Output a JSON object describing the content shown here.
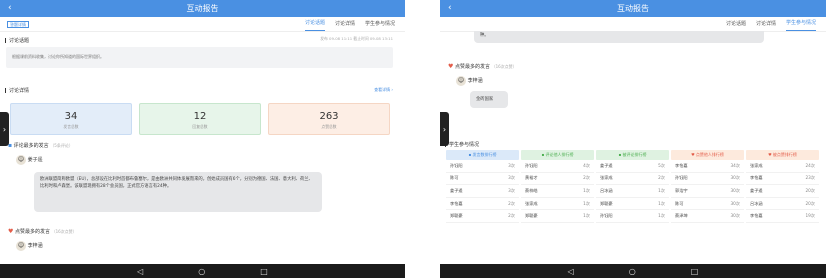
{
  "header": {
    "title": "互动报告",
    "back": "‹"
  },
  "tabs": [
    "讨论话题",
    "讨论详情",
    "学生参与情况"
  ],
  "tag": "答题详情",
  "left": {
    "topic_section": "讨论话题",
    "meta": "发布 09-08 11:11   截止时间 09-08 13:11",
    "topic_text": "根据课前资料收集，讨论你所知道的国际世界组织。",
    "detail_section": "讨论详情",
    "detail_link": "查看详情 ›",
    "stats": [
      {
        "value": "34",
        "label": "发言总数"
      },
      {
        "value": "12",
        "label": "回复总数"
      },
      {
        "value": "263",
        "label": "点赞总数"
      }
    ],
    "best_section": "评论最多的发言",
    "best_hint": "（5条评论）",
    "best_name": "姜子遥",
    "best_text": "欧洲联盟简称欧盟（EU），总部设在比利时首都布鲁塞尔，是由欧洲共同体发展而来的，创始成员国有6个，分别为德国、法国、意大利、荷兰、比利时和卢森堡。该联盟现拥有28个会员国，正式官方语言有24种。",
    "like_section": "点赞最多的发言",
    "like_hint": "（16次点赞）",
    "like_name": "李梓涵"
  },
  "right": {
    "top_fragment": "种。",
    "like_section": "点赞最多的发言",
    "like_hint": "（16次点赞）",
    "like_name": "李梓涵",
    "like_text": "金砖国家",
    "participation_section": "学生参与情况",
    "columns": [
      {
        "title": "发言数排行榜",
        "icon": "comment-icon",
        "bg": "#dbe9f9",
        "color": "#4a90e2",
        "rows": [
          [
            "孙钰阳",
            "3次"
          ],
          [
            "陈可",
            "3次"
          ],
          [
            "姜子遥",
            "3次"
          ],
          [
            "李怡嘉",
            "2次"
          ],
          [
            "郑聪豪",
            "2次"
          ]
        ]
      },
      {
        "title": "评论他人排行榜",
        "icon": "comment-icon",
        "bg": "#dff2e1",
        "color": "#4caf50",
        "rows": [
          [
            "孙钰阳",
            "4次"
          ],
          [
            "黄裕才",
            "2次"
          ],
          [
            "蔡梓皓",
            "1次"
          ],
          [
            "张家成",
            "1次"
          ],
          [
            "郑聪豪",
            "1次"
          ]
        ]
      },
      {
        "title": "被评论排行榜",
        "icon": "comment-icon",
        "bg": "#dff2e1",
        "color": "#4caf50",
        "rows": [
          [
            "姜子遥",
            "5次"
          ],
          [
            "张家成",
            "2次"
          ],
          [
            "吕冰涵",
            "1次"
          ],
          [
            "郑聪豪",
            "1次"
          ],
          [
            "孙钰阳",
            "1次"
          ]
        ]
      },
      {
        "title": "点赞他人排行榜",
        "icon": "heart-icon",
        "bg": "#fdeadd",
        "color": "#e35d4a",
        "rows": [
          [
            "李怡嘉",
            "34次"
          ],
          [
            "孙钰阳",
            "30次"
          ],
          [
            "郭浩宇",
            "30次"
          ],
          [
            "陈可",
            "30次"
          ],
          [
            "蔡泽坤",
            "30次"
          ]
        ]
      },
      {
        "title": "被点赞排行榜",
        "icon": "heart-icon",
        "bg": "#fdeadd",
        "color": "#e35d4a",
        "rows": [
          [
            "张家成",
            "24次"
          ],
          [
            "李怡嘉",
            "23次"
          ],
          [
            "姜子遥",
            "20次"
          ],
          [
            "吕冰涵",
            "20次"
          ],
          [
            "李怡嘉",
            "19次"
          ]
        ]
      }
    ]
  },
  "nav": {
    "back": "◁",
    "home": "○",
    "recent": "□"
  }
}
